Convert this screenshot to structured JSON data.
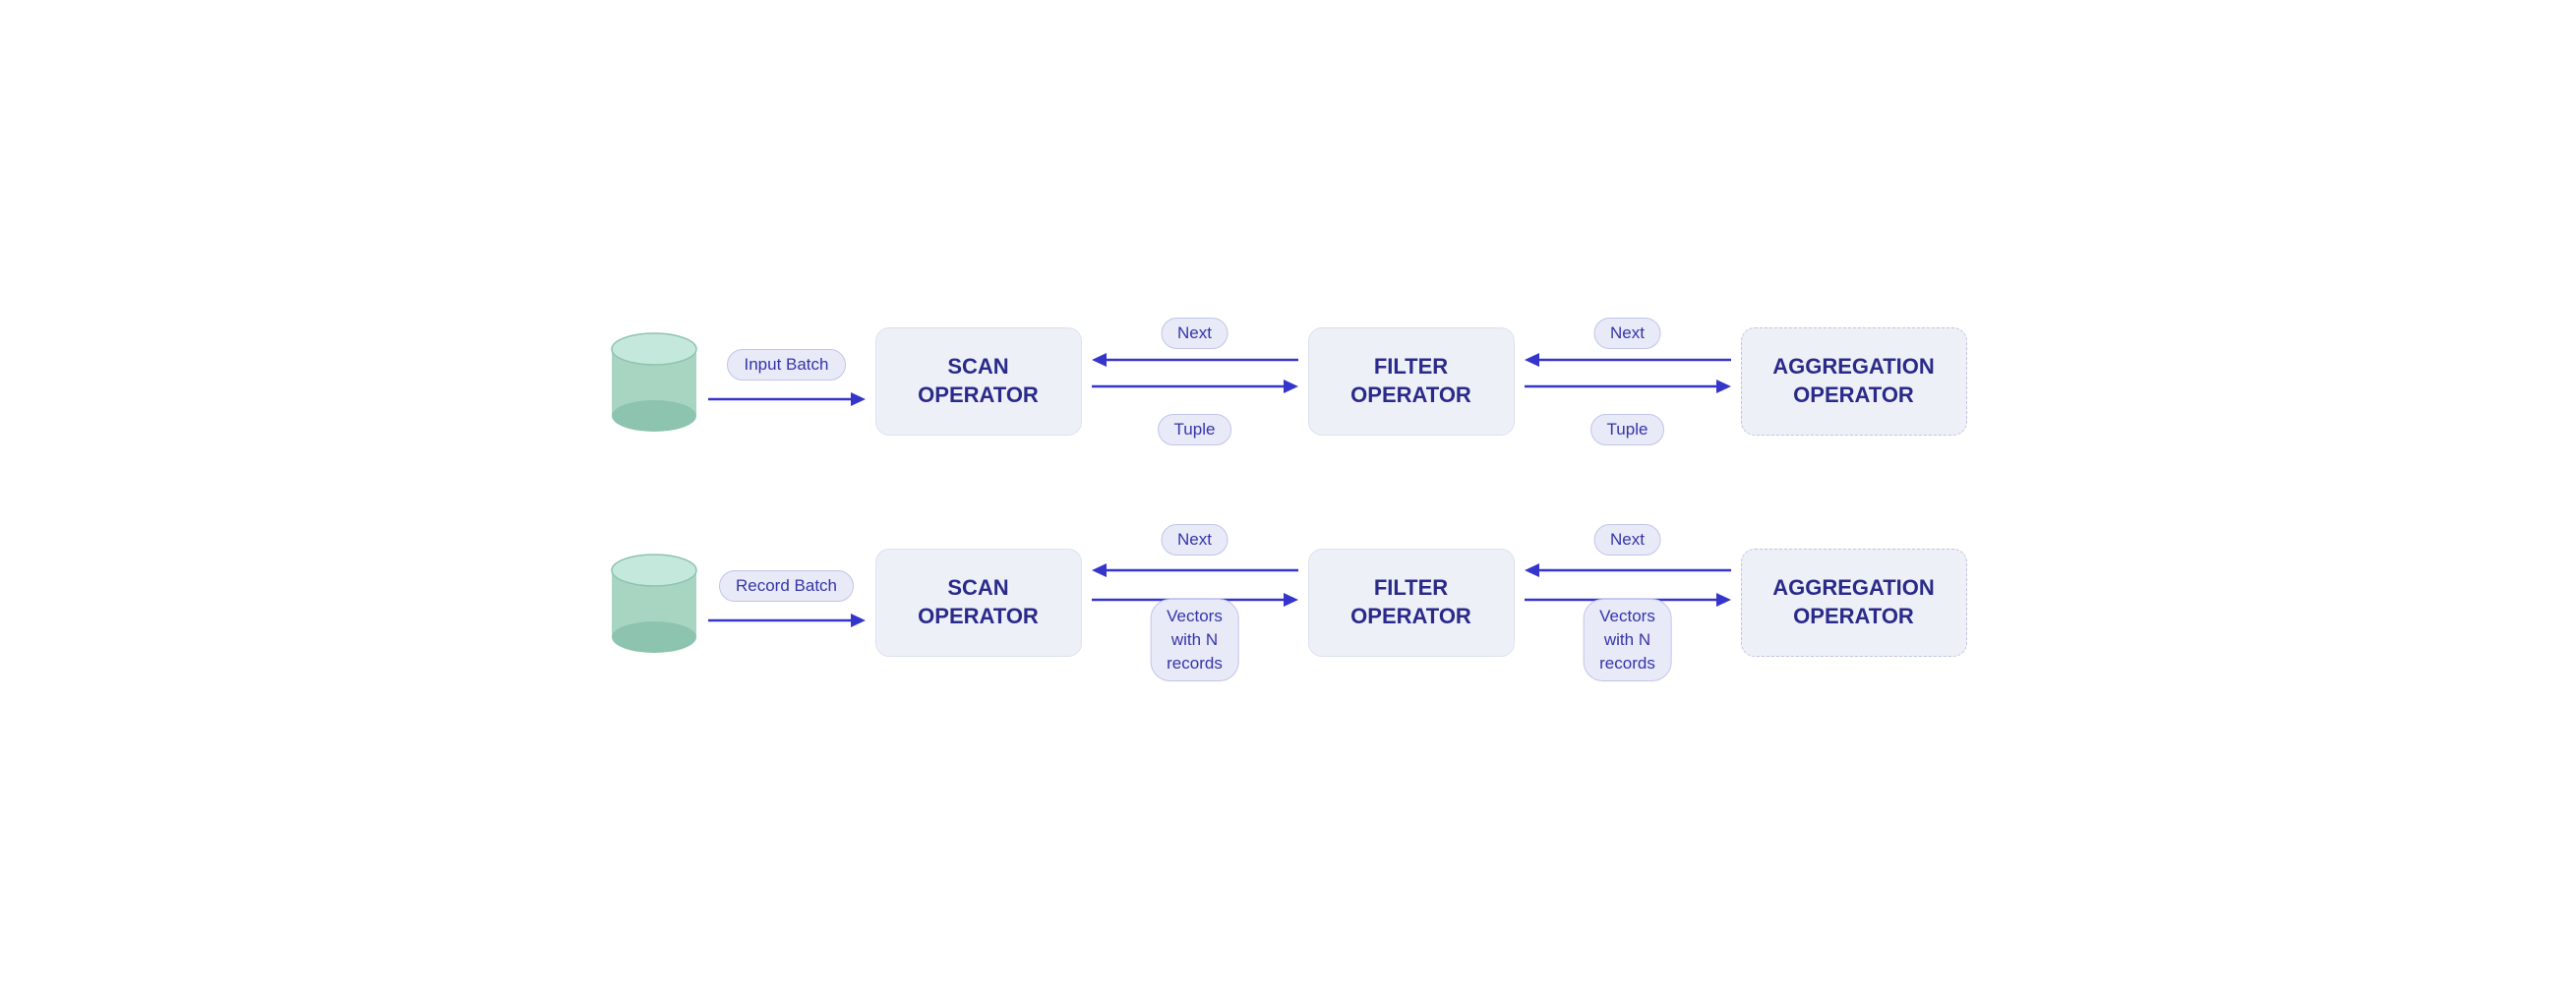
{
  "diagram1": {
    "database_label": "database",
    "input_label": "Input Batch",
    "scan_operator": "SCAN\nOPERATOR",
    "scan_label1": "SCAN",
    "scan_label2": "OPERATOR",
    "filter_label1": "FILTER",
    "filter_label2": "OPERATOR",
    "aggregation_label1": "AGGREGATION",
    "aggregation_label2": "OPERATOR",
    "connector1_top": "Next",
    "connector1_bottom": "Tuple",
    "connector2_top": "Next",
    "connector2_bottom": "Tuple"
  },
  "diagram2": {
    "input_label": "Record Batch",
    "scan_label1": "SCAN",
    "scan_label2": "OPERATOR",
    "filter_label1": "FILTER",
    "filter_label2": "OPERATOR",
    "aggregation_label1": "AGGREGATION",
    "aggregation_label2": "OPERATOR",
    "connector1_top": "Next",
    "connector1_bottom": "Vectors\nwith N\nrecords",
    "connector2_top": "Next",
    "connector2_bottom": "Vectors\nwith N\nrecords"
  }
}
